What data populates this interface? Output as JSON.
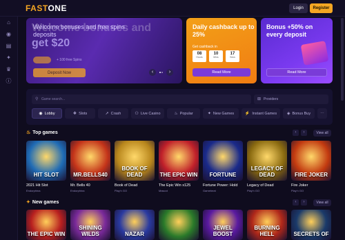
{
  "header": {
    "logo_part1": "FAST",
    "logo_part2": "ONE",
    "login_label": "Login",
    "register_label": "Register"
  },
  "rail": {
    "icons": [
      "home-icon",
      "gamepad-icon",
      "cards-icon",
      "gift-icon",
      "trophy-icon",
      "info-icon"
    ]
  },
  "banners": {
    "welcome": {
      "ghost_text": "Welcome bonuses and",
      "title": "Welcome bonuses and free spins deposits",
      "amount": "get $20",
      "small_text": "+ 100 free Spins",
      "cta_label": "Deposit Now"
    },
    "cashback": {
      "title": "Daily cashback up to 25%",
      "sub": "Get cashback in",
      "timer": [
        {
          "value": "08",
          "unit": "Hours"
        },
        {
          "value": "10",
          "unit": "Mins"
        },
        {
          "value": "17",
          "unit": "Secs"
        }
      ],
      "cta_label": "Read More"
    },
    "bonus50": {
      "title": "Bonus +50% on every deposit",
      "cta_label": "Read More"
    }
  },
  "search": {
    "placeholder": "Game search...",
    "providers_label": "Providers"
  },
  "categories": [
    {
      "label": "Lobby",
      "icon": "gamepad-icon",
      "active": true
    },
    {
      "label": "Slots",
      "icon": "slot-icon",
      "active": false
    },
    {
      "label": "Crash",
      "icon": "rocket-icon",
      "active": false
    },
    {
      "label": "Live Casino",
      "icon": "live-icon",
      "active": false
    },
    {
      "label": "Popular",
      "icon": "fire-icon",
      "active": false
    },
    {
      "label": "New Games",
      "icon": "star-icon",
      "active": false
    },
    {
      "label": "Instant Games",
      "icon": "bolt-icon",
      "active": false
    },
    {
      "label": "Bonus Buy",
      "icon": "cart-icon",
      "active": false
    }
  ],
  "top_games": {
    "title": "Top games",
    "view_all": "View all",
    "games": [
      {
        "name": "2021 Hit Slot",
        "provider": "Endorphina",
        "art": "HIT SLOT",
        "color": "#1f6bb5"
      },
      {
        "name": "Mr. Bells 40",
        "provider": "Endorphina",
        "art": "MR.BELLS40",
        "color": "#c4341a"
      },
      {
        "name": "Book of Dead",
        "provider": "Play'n GO",
        "art": "BOOK OF DEAD",
        "color": "#b8861c"
      },
      {
        "name": "The Epic Win x125",
        "provider": "Mascot",
        "art": "THE EPIC WIN",
        "color": "#c0202a"
      },
      {
        "name": "Fortune Power: Hold",
        "provider": "Gamebeat",
        "art": "FORTUNE",
        "color": "#1a2a8a"
      },
      {
        "name": "Legacy of Dead",
        "provider": "Play'n GO",
        "art": "LEGACY OF DEAD",
        "color": "#8a6a10"
      },
      {
        "name": "Fire Joker",
        "provider": "Play'n GO",
        "art": "FIRE JOKER",
        "color": "#c23a10"
      }
    ]
  },
  "new_games": {
    "title": "New games",
    "view_all": "View all",
    "games": [
      {
        "art": "THE EPIC WIN",
        "color": "#b8201f"
      },
      {
        "art": "SHINING WILDS",
        "color": "#7a2a9a"
      },
      {
        "art": "NAZAR",
        "color": "#2a3aa0"
      },
      {
        "art": "",
        "color": "#2a7a2a"
      },
      {
        "art": "JEWEL BOOST",
        "color": "#5a1aa0"
      },
      {
        "art": "BURNING HELL",
        "color": "#b0281a"
      },
      {
        "art": "SECRETS OF",
        "color": "#1a3a6a"
      }
    ]
  }
}
